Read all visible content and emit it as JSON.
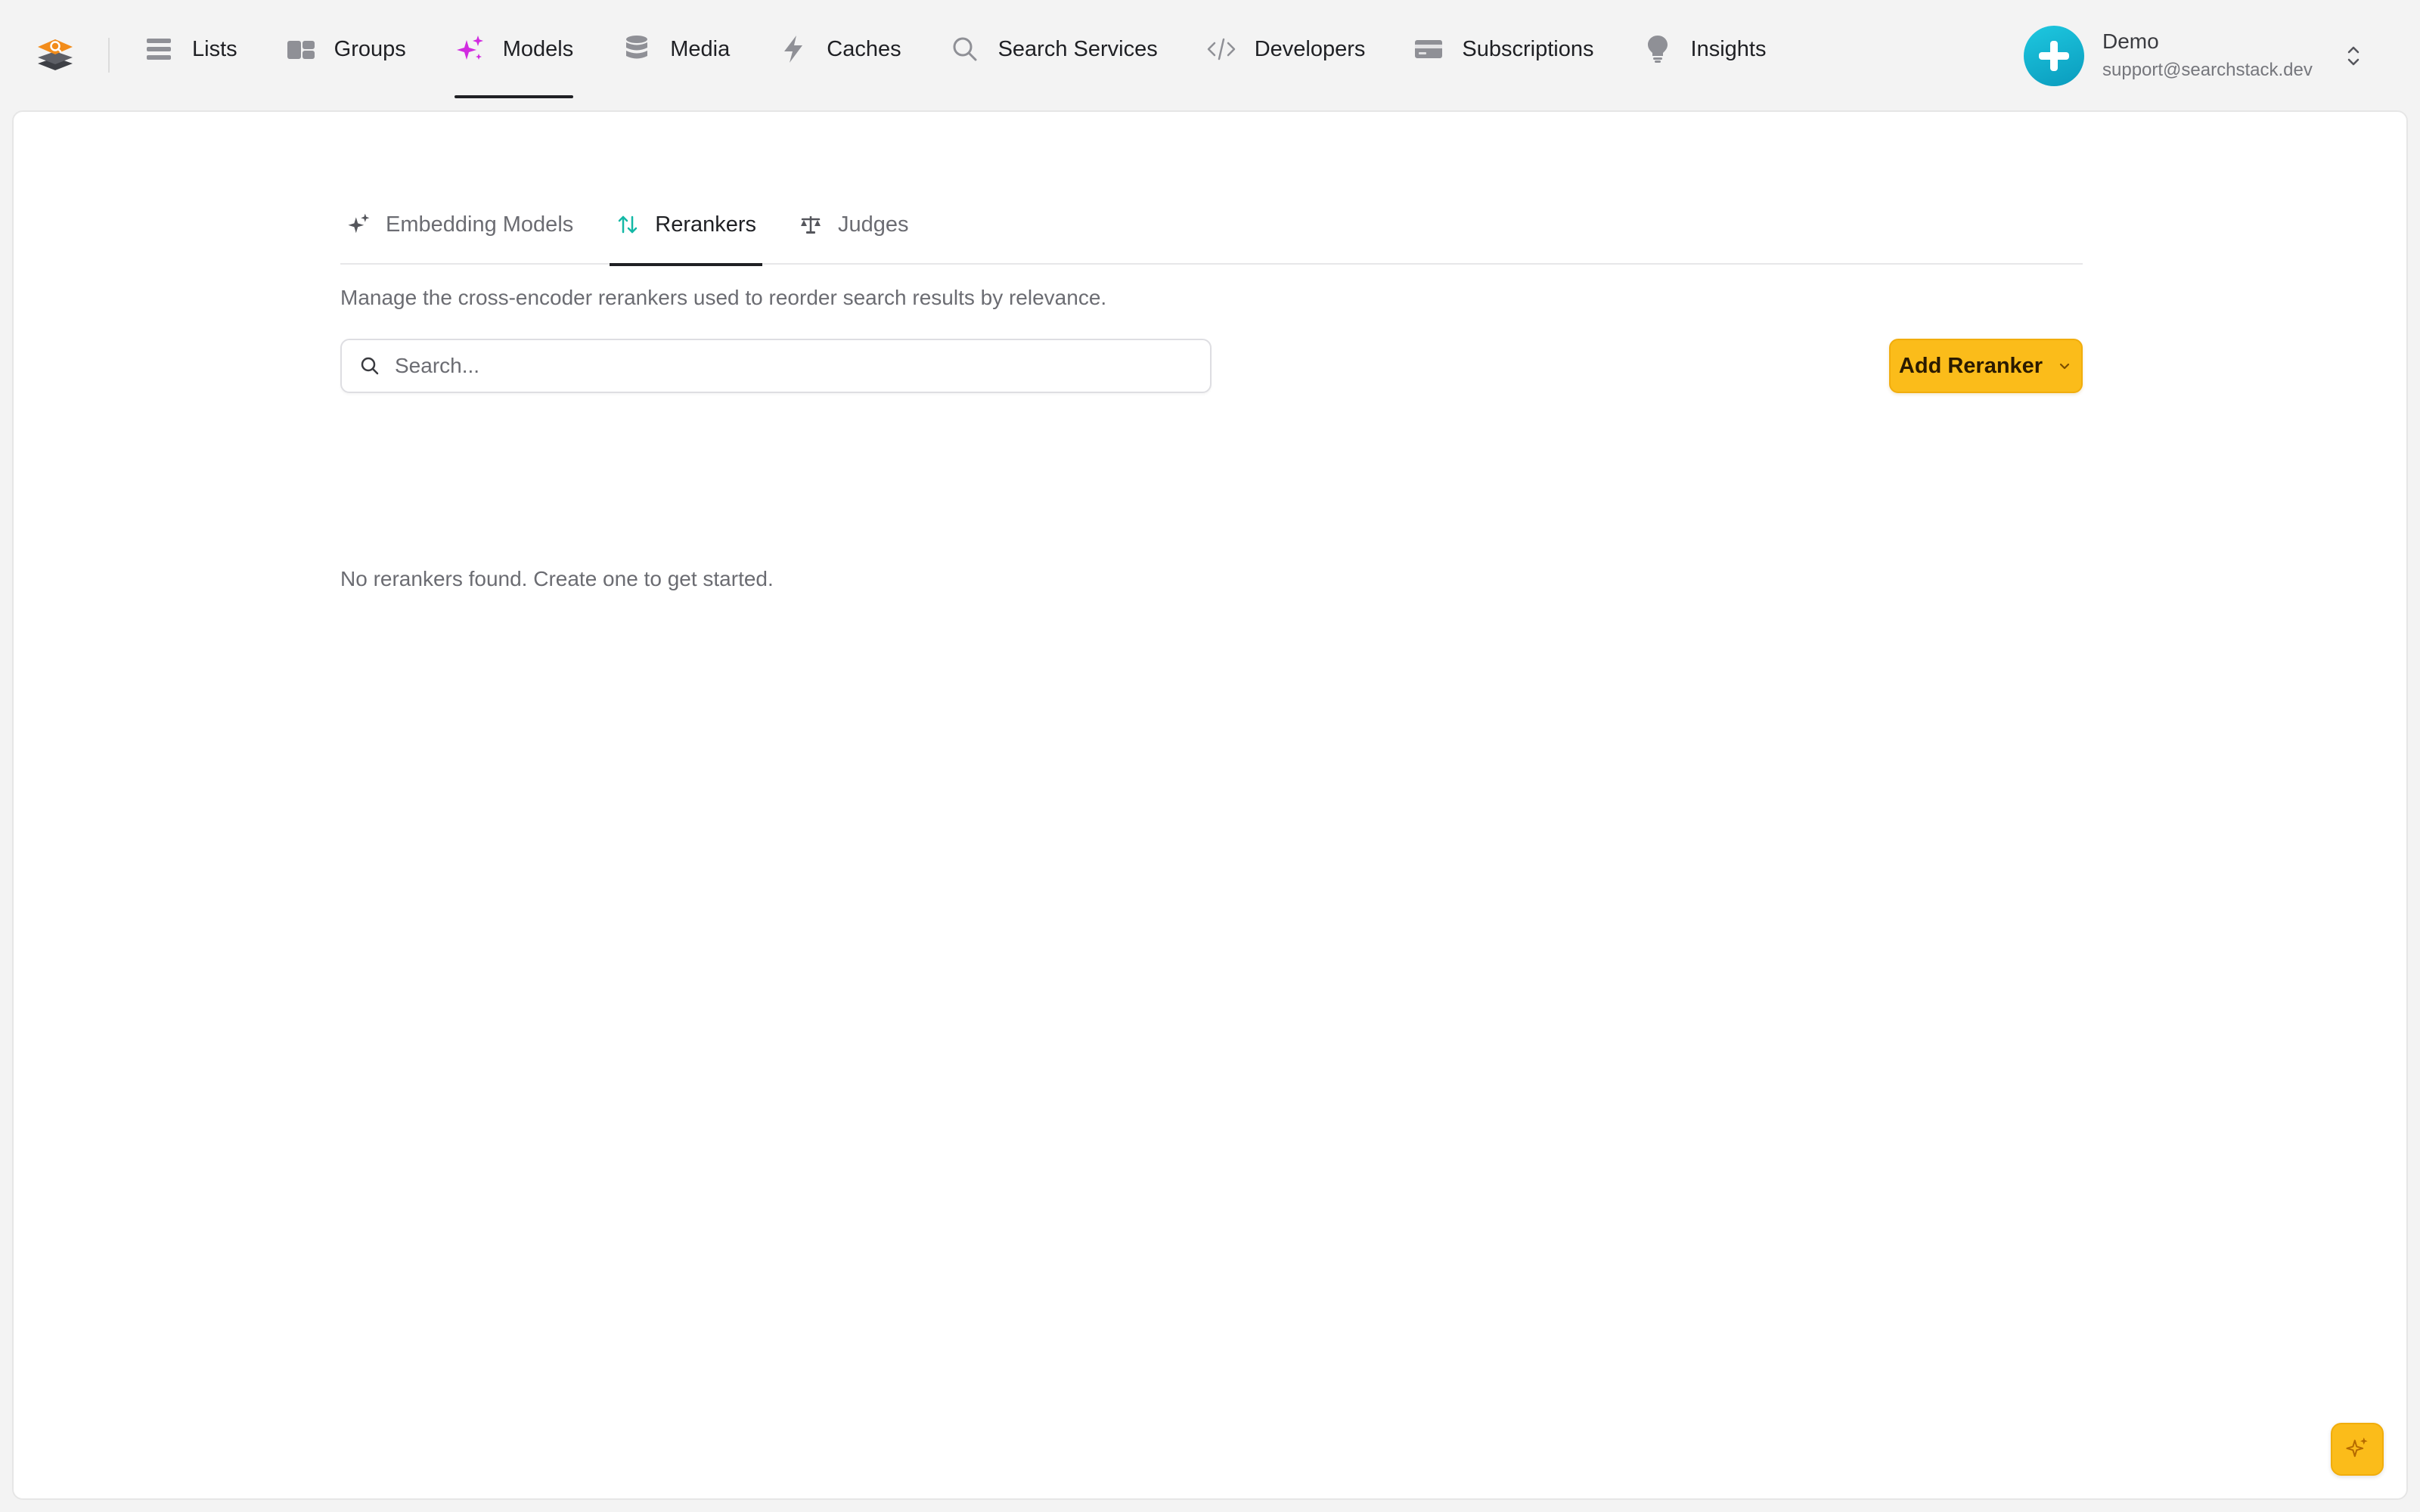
{
  "nav": {
    "items": [
      {
        "label": "Lists",
        "icon": "list-icon"
      },
      {
        "label": "Groups",
        "icon": "groups-icon"
      },
      {
        "label": "Models",
        "icon": "sparkles-icon",
        "active": true
      },
      {
        "label": "Media",
        "icon": "database-icon"
      },
      {
        "label": "Caches",
        "icon": "bolt-icon"
      },
      {
        "label": "Search Services",
        "icon": "search-icon"
      },
      {
        "label": "Developers",
        "icon": "code-icon"
      },
      {
        "label": "Subscriptions",
        "icon": "credit-card-icon"
      },
      {
        "label": "Insights",
        "icon": "lightbulb-icon"
      }
    ]
  },
  "account": {
    "name": "Demo",
    "email": "support@searchstack.dev"
  },
  "tabs": [
    {
      "label": "Embedding Models",
      "icon": "sparkles-icon"
    },
    {
      "label": "Rerankers",
      "icon": "sort-arrows-icon",
      "active": true
    },
    {
      "label": "Judges",
      "icon": "scale-icon"
    }
  ],
  "page": {
    "description": "Manage the cross-encoder rerankers used to reorder search results by relevance.",
    "search_placeholder": "Search...",
    "add_button_label": "Add Reranker",
    "empty_message": "No rerankers found. Create one to get started."
  },
  "colors": {
    "accent": "#fbbc1a",
    "models_icon": "#d12be0",
    "rerankers_icon": "#14b8a6",
    "avatar": "#12b3d0"
  }
}
